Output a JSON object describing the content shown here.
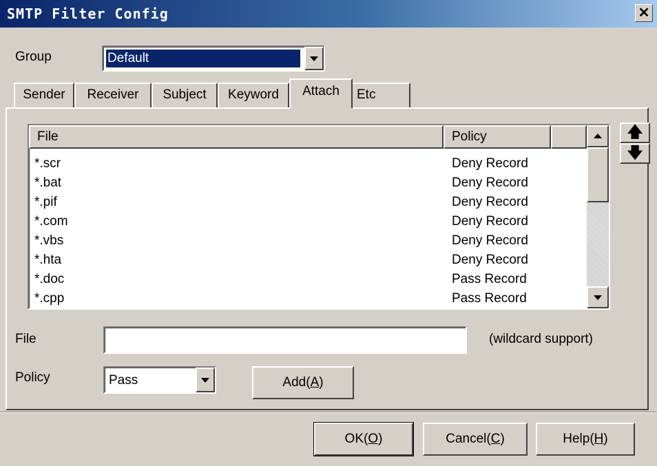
{
  "window": {
    "title": "SMTP Filter Config",
    "close_glyph": "✕"
  },
  "group": {
    "label": "Group",
    "value": "Default"
  },
  "tabs": [
    {
      "label": "Sender"
    },
    {
      "label": "Receiver"
    },
    {
      "label": "Subject"
    },
    {
      "label": "Keyword"
    },
    {
      "label": "Attach",
      "active": true
    },
    {
      "label": "Etc"
    }
  ],
  "list": {
    "columns": [
      "File",
      "Policy"
    ],
    "rows": [
      {
        "file": "*.scr",
        "policy": "Deny Record"
      },
      {
        "file": "*.bat",
        "policy": "Deny Record"
      },
      {
        "file": "*.pif",
        "policy": "Deny Record"
      },
      {
        "file": "*.com",
        "policy": "Deny Record"
      },
      {
        "file": "*.vbs",
        "policy": "Deny Record"
      },
      {
        "file": "*.hta",
        "policy": "Deny Record"
      },
      {
        "file": "*.doc",
        "policy": "Pass Record"
      },
      {
        "file": "*.cpp",
        "policy": "Pass Record"
      }
    ]
  },
  "move_up_glyph": "🡅",
  "move_down_glyph": "🡇",
  "file_field": {
    "label": "File",
    "value": "",
    "hint": "(wildcard support)"
  },
  "policy_field": {
    "label": "Policy",
    "value": "Pass"
  },
  "buttons": {
    "add_text": "Add(",
    "add_key": "A",
    "ok_text": "OK(",
    "ok_key": "O",
    "cancel_text": "Cancel(",
    "cancel_key": "C",
    "help_text": "Help(",
    "help_key": "H",
    "close_paren": ")"
  },
  "colors": {
    "title_start": "#0a246a",
    "title_end": "#a6caf0",
    "face": "#d4d0c8",
    "selection": "#0a246a"
  }
}
